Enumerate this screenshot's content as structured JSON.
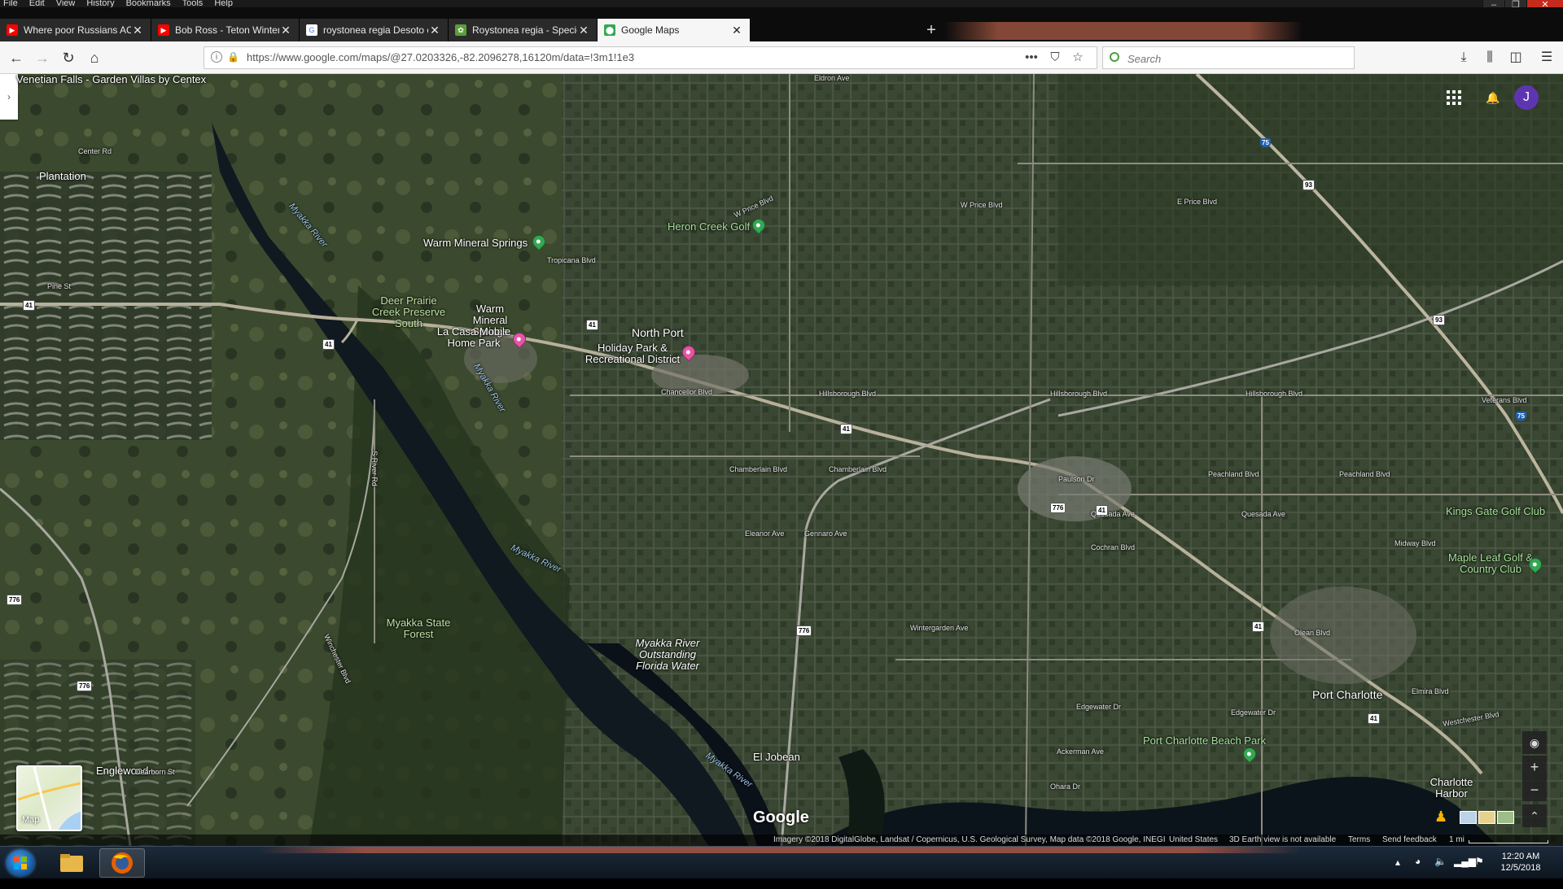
{
  "browser": {
    "menu": [
      "File",
      "Edit",
      "View",
      "History",
      "Bookmarks",
      "Tools",
      "Help"
    ],
    "tabs": [
      {
        "title": "Where poor Russians ACTUALL",
        "favicon": "youtube-icon",
        "active": false
      },
      {
        "title": "Bob Ross - Teton Winter (Seas",
        "favicon": "youtube-icon",
        "active": false
      },
      {
        "title": "roystonea regia Desoto county",
        "favicon": "google-icon",
        "active": false
      },
      {
        "title": "Roystonea regia - Species Page",
        "favicon": "species-page-icon",
        "active": false
      },
      {
        "title": "Google Maps",
        "favicon": "google-maps-icon",
        "active": true
      }
    ],
    "url": "https://www.google.com/maps/@27.0203326,-82.2096278,16120m/data=!3m1!1e3",
    "search_placeholder": "Search",
    "colors": {
      "accent_active_tab": "#f6f6f6",
      "titlebar": "#0c0c0c",
      "glow": "#e6785a"
    }
  },
  "map": {
    "user_initial": "J",
    "places": [
      {
        "name": "Venetian Falls - Garden Villas by Centex",
        "kind": "place"
      },
      {
        "name": "Plantation",
        "kind": "place"
      },
      {
        "name": "Warm Mineral Springs",
        "kind": "park"
      },
      {
        "name": "Heron Creek Golf",
        "kind": "golf"
      },
      {
        "name": "Deer Prairie Creek Preserve South",
        "kind": "park"
      },
      {
        "name": "Warm Mineral Springs",
        "kind": "place"
      },
      {
        "name": "La Casa Mobile Home Park",
        "kind": "lodging"
      },
      {
        "name": "North Port",
        "kind": "city"
      },
      {
        "name": "Holiday Park & Recreational District",
        "kind": "park"
      },
      {
        "name": "Myakka State Forest",
        "kind": "park"
      },
      {
        "name": "Myakka River Outstanding Florida Water",
        "kind": "water"
      },
      {
        "name": "El Jobean",
        "kind": "place"
      },
      {
        "name": "Englewood",
        "kind": "place"
      },
      {
        "name": "Port Charlotte",
        "kind": "city"
      },
      {
        "name": "Port Charlotte Beach Park",
        "kind": "park"
      },
      {
        "name": "Charlotte Harbor",
        "kind": "place"
      },
      {
        "name": "Kings Gate Golf Club",
        "kind": "golf"
      },
      {
        "name": "Maple Leaf Golf & Country Club",
        "kind": "golf"
      }
    ],
    "rivers": [
      "Myakka River",
      "Myakka River",
      "Myakka River",
      "Myakka River"
    ],
    "roads": [
      "Eldron Ave",
      "W Price Blvd",
      "W Price Blvd",
      "E Price Blvd",
      "Hillsborough Blvd",
      "Hillsborough Blvd",
      "Hillsborough Blvd",
      "Chancellor Blvd",
      "Chamberlain Blvd",
      "Chamberlain Blvd",
      "Eleanor Ave",
      "Gennaro Ave",
      "Quesada Ave",
      "Quesada Ave",
      "Peachland Blvd",
      "Peachland Blvd",
      "Midway Blvd",
      "Veterans Blvd",
      "Wintergarden Ave",
      "Edgewater Dr",
      "Edgewater Dr",
      "Ackerman Ave",
      "Ohara Dr",
      "Cochran Blvd",
      "Paulson Dr",
      "Tropicana Blvd",
      "S River Rd",
      "Winchester Blvd",
      "Dearborn St",
      "Center Rd",
      "Pine St",
      "Elmira Blvd",
      "Olean Blvd",
      "Westchester Blvd"
    ],
    "highways": [
      "41",
      "41",
      "41",
      "41",
      "41",
      "41",
      "41",
      "776",
      "776",
      "776",
      "776",
      "93",
      "93"
    ],
    "interstates": [
      "75",
      "75"
    ],
    "brand": "Google",
    "minimap_label": "Map",
    "attribution": {
      "imagery": "Imagery ©2018 DigitalGlobe, Landsat / Copernicus, U.S. Geological Survey, Map data ©2018 Google, INEGI",
      "country": "United States",
      "earth_note": "3D Earth view is not available",
      "terms": "Terms",
      "feedback": "Send feedback",
      "scale": "1 mi"
    }
  },
  "taskbar": {
    "time": "12:20 AM",
    "date": "12/5/2018"
  }
}
